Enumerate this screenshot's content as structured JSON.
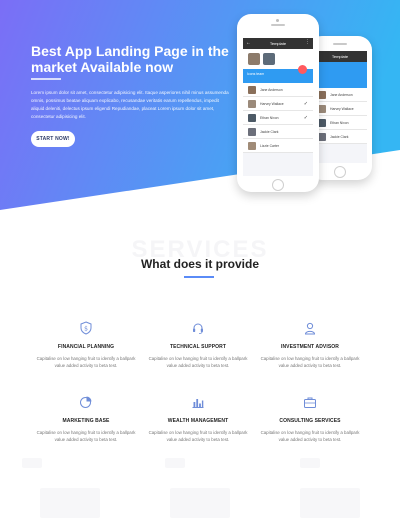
{
  "colors": {
    "hero_start": "#7b6ef6",
    "hero_end": "#35b6f3",
    "accent": "#5a8bf7",
    "icon": "#6f8dd8"
  },
  "hero": {
    "title": "Best App Landing Page in the market Available now",
    "text": "Lorem ipsum dolor sit amet, consectetur adipisicing elit. Itaque asperiores nihil minus assumenda omnis, possimus beatae aliquam explicabo, recusandae veritatis earum repellendus, impedit aliquid deleniti, delectus ipsum eligendi Repudiandae, placeat Lorem ipsum dolor sit amet, consectetur adipisicing elit.",
    "button": "START NOW!"
  },
  "phone_front": {
    "appbar_title": "Template",
    "band_text": "Icons team",
    "rows": [
      "Jane Anderson",
      "Harvey Wallace",
      "Ethan Nixon",
      "Jackie Clark",
      "Lizzie Carter"
    ]
  },
  "phone_back": {
    "appbar_title": "Template",
    "rows": [
      "Jane Anderson",
      "Harvey Wallace",
      "Ethan Nixon",
      "Jackie Clark",
      "Lizzie Carter"
    ]
  },
  "services": {
    "watermark": "SERVICES",
    "title": "What does it provide",
    "items": [
      {
        "title": "FINANCIAL PLANNING",
        "desc": "Capitalise on low hanging fruit to identify a ballpark value added activity to beta test.",
        "icon": "shield-dollar-icon"
      },
      {
        "title": "TECHNICAL SUPPORT",
        "desc": "Capitalise on low hanging fruit to identify a ballpark value added activity to beta test.",
        "icon": "headset-icon"
      },
      {
        "title": "INVESTMENT ADVISOR",
        "desc": "Capitalise on low hanging fruit to identify a ballpark value added activity to beta test.",
        "icon": "user-icon"
      },
      {
        "title": "MARKETING BASE",
        "desc": "Capitalise on low hanging fruit to identify a ballpark value added activity to beta test.",
        "icon": "pie-chart-icon"
      },
      {
        "title": "WEALTH MANAGEMENT",
        "desc": "Capitalise on low hanging fruit to identify a ballpark value added activity to beta test.",
        "icon": "bar-chart-icon"
      },
      {
        "title": "CONSULTING SERVICES",
        "desc": "Capitalise on low hanging fruit to identify a ballpark value added activity to beta test.",
        "icon": "briefcase-icon"
      }
    ]
  }
}
